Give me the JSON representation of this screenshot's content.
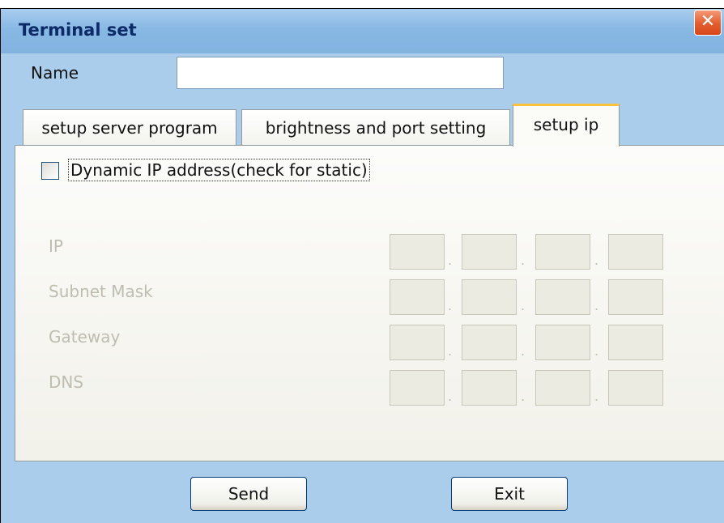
{
  "window": {
    "title": "Terminal set",
    "close_glyph": "✕"
  },
  "name_field": {
    "label": "Name",
    "value": ""
  },
  "tabs": [
    {
      "label": "setup server program",
      "active": false
    },
    {
      "label": "brightness and port setting",
      "active": false
    },
    {
      "label": "setup ip",
      "active": true
    }
  ],
  "ip_panel": {
    "dynamic_checkbox": {
      "label": "Dynamic IP address(check for static)",
      "checked": false
    },
    "fields": [
      {
        "label": "IP",
        "octets": [
          "",
          "",
          "",
          ""
        ]
      },
      {
        "label": "Subnet Mask",
        "octets": [
          "",
          "",
          "",
          ""
        ]
      },
      {
        "label": "Gateway",
        "octets": [
          "",
          "",
          "",
          ""
        ]
      },
      {
        "label": "DNS",
        "octets": [
          "",
          "",
          "",
          ""
        ]
      }
    ],
    "separator": "."
  },
  "buttons": {
    "send": "Send",
    "exit": "Exit"
  },
  "colors": {
    "titlebar": "#88b8e4",
    "window_bg": "#a9cdeb",
    "active_tab_accent": "#ffc23c",
    "close_button": "#e35c2c",
    "disabled_text": "#bdbdb0"
  }
}
